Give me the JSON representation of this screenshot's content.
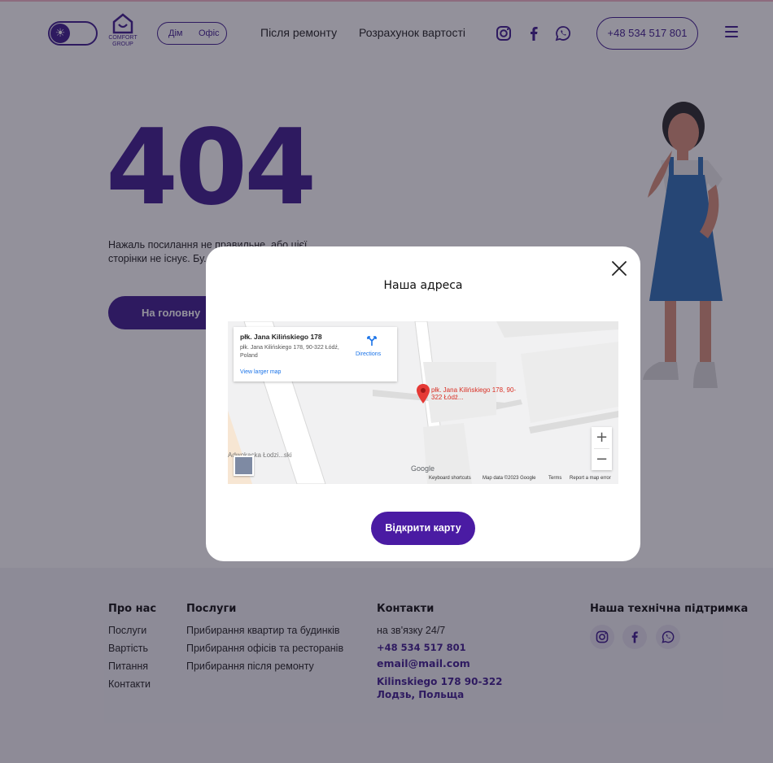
{
  "header": {
    "logo_line1": "COMFORT",
    "logo_line2": "GROUP",
    "mode_home": "Дім",
    "mode_office": "Офіс",
    "nav": [
      "Після ремонту",
      "Розрахунок вартості"
    ],
    "phone": "+48 534 517 801",
    "icons": [
      "sun-icon",
      "instagram-icon",
      "facebook-icon",
      "whatsapp-icon",
      "menu-icon"
    ]
  },
  "error": {
    "code": "404",
    "text": "Нажаль посилання не правильне, або цієї сторінки не існує. Бу... Головну сторінку на...",
    "home_button": "На головну"
  },
  "modal": {
    "title": "Наша адреса",
    "open_map_button": "Відкрити карту",
    "map": {
      "place_title": "płk. Jana Kilińskiego 178",
      "place_address": "płk. Jana Kilińskiego 178, 90-322 Łódź, Poland",
      "directions": "Directions",
      "view_larger": "View larger map",
      "pin_label": "płk. Jana Kilińskiego 178, 90-322 Łódź...",
      "street_label": "Adwokacka Łodzi...ski",
      "zoom_in": "+",
      "zoom_out": "−",
      "google": "Google",
      "footer_links": [
        "Keyboard shortcuts",
        "Map data ©2023 Google",
        "Terms",
        "Report a map error"
      ]
    }
  },
  "footer": {
    "about": {
      "title": "Про нас",
      "links": [
        "Послуги",
        "Вартість",
        "Питання",
        "Контакти"
      ]
    },
    "services": {
      "title": "Послуги",
      "links": [
        "Прибирання квартир та будинків",
        "Прибирання офісів та ресторанів",
        "Прибирання після ремонту"
      ]
    },
    "contacts": {
      "title": "Контакти",
      "availability": "на зв'язку 24/7",
      "phone": "+48 534 517 801",
      "email": "email@mail.com",
      "address": "Kilinskiego 178 90-322 Лодзь, Польща"
    },
    "support": {
      "title": "Наша технічна підтримка"
    }
  },
  "colors": {
    "brand": "#3e1b8f",
    "button": "#4a1ba3"
  }
}
